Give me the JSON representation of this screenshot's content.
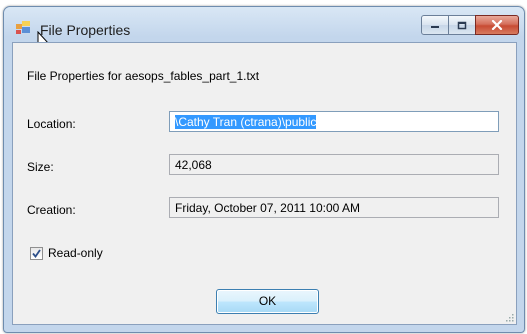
{
  "window": {
    "title": "File Properties"
  },
  "heading": "File Properties for  aesops_fables_part_1.txt",
  "fields": {
    "location": {
      "label": "Location:",
      "value": "\\Cathy Tran (ctrana)\\public"
    },
    "size": {
      "label": "Size:",
      "value": "42,068"
    },
    "creation": {
      "label": "Creation:",
      "value": "Friday, October 07, 2011 10:00 AM"
    }
  },
  "readonly": {
    "label": "Read-only",
    "checked": true
  },
  "buttons": {
    "ok": "OK"
  },
  "icons": {
    "app": "app-icon",
    "minimize": "minimize-icon",
    "maximize": "maximize-icon",
    "close": "close-icon",
    "cursor": "cursor-icon"
  },
  "colors": {
    "selection": "#3399ff",
    "close_button": "#c84b33"
  }
}
